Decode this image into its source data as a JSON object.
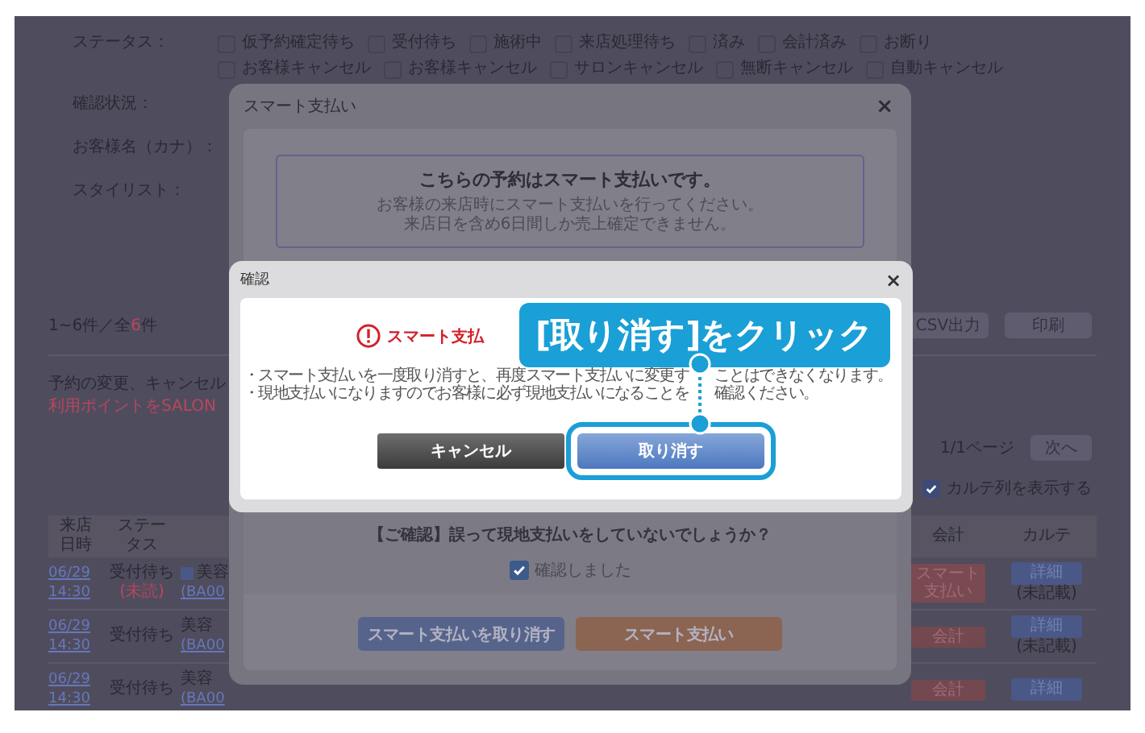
{
  "filters": {
    "status": {
      "label": "ステータス：",
      "options": [
        {
          "label": "仮予約確定待ち",
          "checked": false
        },
        {
          "label": "受付待ち",
          "checked": false
        },
        {
          "label": "施術中",
          "checked": false
        },
        {
          "label": "来店処理待ち",
          "checked": false
        },
        {
          "label": "済み",
          "checked": false
        },
        {
          "label": "会計済み",
          "checked": false
        },
        {
          "label": "お断り",
          "checked": false
        },
        {
          "label": "お客様キャンセル",
          "checked": false
        },
        {
          "label": "お客様キャンセル",
          "checked": false
        },
        {
          "label": "サロンキャンセル",
          "checked": false
        },
        {
          "label": "無断キャンセル",
          "checked": false
        },
        {
          "label": "自動キャンセル",
          "checked": false
        }
      ]
    },
    "other_labels": [
      "確認状況：",
      "お客様名（カナ）：",
      "スタイリスト："
    ]
  },
  "results": {
    "count_prefix": "1~6件／全",
    "count_total": "6",
    "count_suffix": "件"
  },
  "export_buttons": [
    "CSV出力",
    "印刷"
  ],
  "notes": [
    {
      "text": "予約の変更、キャンセル",
      "kind": "plain"
    },
    {
      "text": "利用ポイントをSALON",
      "kind": "alert"
    }
  ],
  "pager": {
    "page": "1/1ページ",
    "next": "次へ"
  },
  "karte_toggle": {
    "label": "カルテ列を表示する",
    "checked": true
  },
  "table": {
    "columns": [
      "来店日時",
      "ステータス",
      "会計",
      "カルテ"
    ],
    "rows": [
      {
        "date": "06/29",
        "time": "14:30",
        "status": "受付待ち",
        "status_note": "(未読)",
        "customer": "美容",
        "customer_id": "(BA00",
        "payment": {
          "label": "スマート支払い",
          "kind": "smart"
        },
        "karte": "詳細",
        "karte_note": "(未記載)"
      },
      {
        "date": "06/29",
        "time": "14:30",
        "status": "受付待ち",
        "customer": "美容",
        "customer_id": "(BA00",
        "payment": {
          "label": "会計",
          "kind": "normal"
        },
        "karte": "詳細",
        "karte_note": "(未記載)"
      },
      {
        "date": "06/29",
        "time": "14:30",
        "status": "受付待ち",
        "customer": "美容",
        "customer_id": "(BA00",
        "payment": {
          "label": "会計",
          "kind": "normal"
        },
        "karte": "詳細"
      }
    ]
  },
  "smart_modal": {
    "title": "スマート支払い",
    "close": "×",
    "notice_heading": "こちらの予約はスマート支払いです。",
    "notice_lines": [
      "お客様の来店時にスマート支払いを行ってください。",
      "来店日を含め6日間しか売上確定できません。"
    ],
    "question": "【ご確認】誤って現地支払いをしていないでしょうか？",
    "confirm_check": {
      "label": "確認しました",
      "checked": true
    },
    "buttons": [
      {
        "label": "スマート支払いを取り消す",
        "kind": "cancel"
      },
      {
        "label": "スマート支払い",
        "kind": "pay"
      }
    ]
  },
  "confirm_dialog": {
    "title": "確認",
    "close": "×",
    "heading": "スマート支払",
    "bullets": [
      {
        "parts": [
          "・スマート支払いを一度取り消すと、再度スマート支払いに変更す",
          "ことはできなくなります。"
        ]
      },
      {
        "parts": [
          "・現地支払いになりますのでお客様に必ず現地支払いになることを",
          "確認ください。"
        ]
      }
    ],
    "buttons": [
      {
        "label": "キャンセル",
        "kind": "secondary",
        "highlighted": false
      },
      {
        "label": "取り消す",
        "kind": "primary",
        "highlighted": true
      }
    ]
  },
  "callout": {
    "text": "[取り消す]をクリック"
  }
}
